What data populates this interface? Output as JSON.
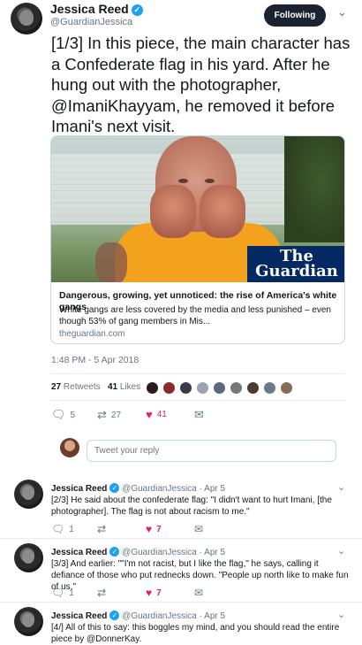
{
  "author": {
    "name": "Jessica Reed",
    "handle": "@GuardianJessica",
    "follow_label": "Following"
  },
  "tweet": {
    "text": "[1/3] In this piece, the main character has a Confederate flag in his yard. After he hung out with the photographer, @ImaniKhayyam, he removed it before Imani's next visit.",
    "timestamp": "1:48 PM - 5 Apr 2018",
    "retweets_count": "27",
    "retweets_label": "Retweets",
    "likes_count": "41",
    "likes_label": "Likes",
    "action_reply_count": "5",
    "action_retweet_count": "27",
    "action_like_count": "41"
  },
  "card": {
    "image_logo_text": "The Guardian",
    "title": "Dangerous, growing, yet unnoticed: the rise of America's white gangs",
    "description": "White gangs are less covered by the media and less punished – even though 53% of gang members in Mis...",
    "domain": "theguardian.com"
  },
  "reply_box": {
    "placeholder": "Tweet your reply"
  },
  "replies": [
    {
      "name": "Jessica Reed",
      "handle": "@GuardianJessica",
      "date": "· Apr 5",
      "text": "[2/3] He said about the confederate flag: \"I didn't want to hurt Imani, [the photographer]. The flag is not about racism to me.\"",
      "reply_count": "1",
      "retweet_count": "",
      "like_count": "7"
    },
    {
      "name": "Jessica Reed",
      "handle": "@GuardianJessica",
      "date": "· Apr 5",
      "text": "[3/3] And earlier: \"\"I'm not racist, but I like the flag,\" he says, calling it defiance of those who put rednecks down. \"People up north like to make fun of us.\"",
      "reply_count": "1",
      "retweet_count": "",
      "like_count": "7"
    },
    {
      "name": "Jessica Reed",
      "handle": "@GuardianJessica",
      "date": "· Apr 5",
      "text": "[4/] All of this to say: this boggles my mind, and you should read the entire piece by @DonnerKay.",
      "reply_count": "",
      "retweet_count": "",
      "like_count": ""
    }
  ],
  "colors": {
    "accent": "#1da1f2",
    "like": "#e0245e",
    "follow_button": "#1c2330",
    "guardian_blue": "#052962"
  },
  "icons": {
    "verified": "verified-badge-icon",
    "reply": "reply-icon",
    "retweet": "retweet-icon",
    "like": "heart-icon",
    "dm": "direct-message-icon",
    "more": "chevron-down-icon"
  }
}
